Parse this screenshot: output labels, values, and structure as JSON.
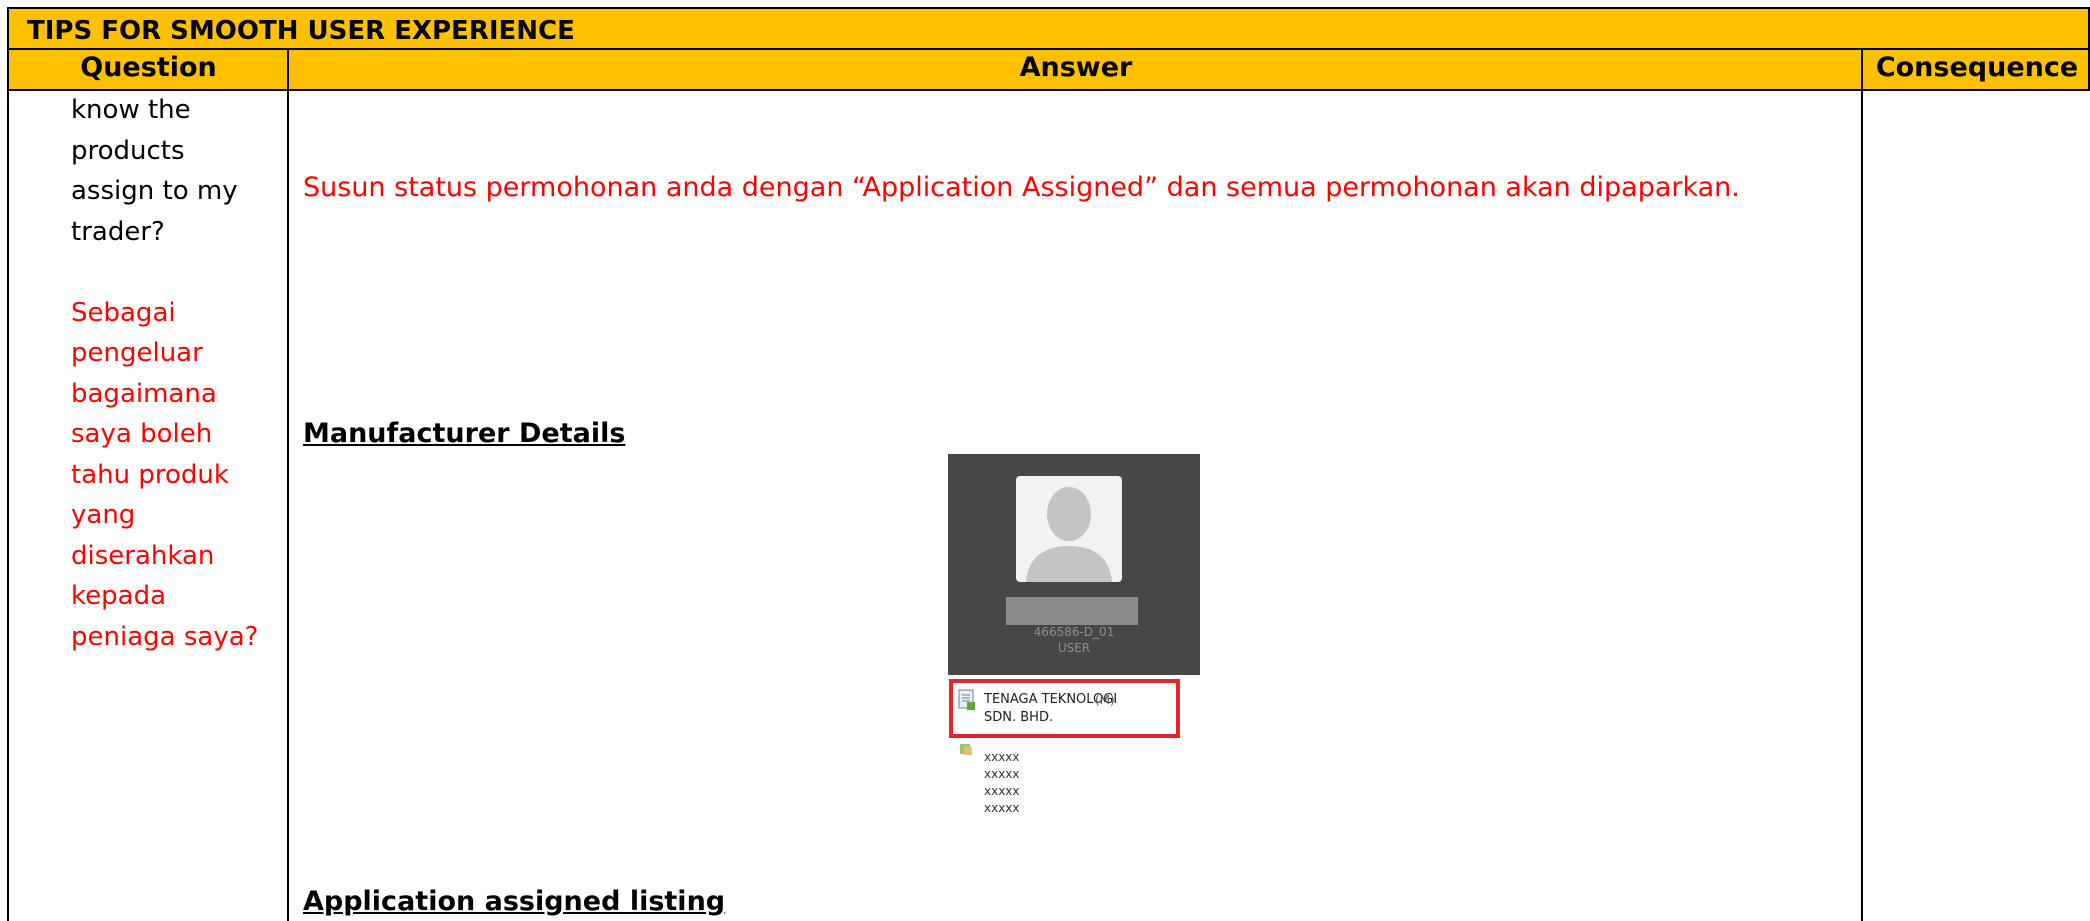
{
  "header": {
    "title": "TIPS FOR SMOOTH USER EXPERIENCE",
    "columns": [
      "Question",
      "Answer",
      "Consequence"
    ]
  },
  "question": {
    "english_lines": [
      "know the",
      "products",
      "assign to my",
      "trader?"
    ],
    "malay_lines": [
      "Sebagai",
      "pengeluar",
      "bagaimana",
      "saya boleh",
      "tahu produk",
      "yang",
      "diserahkan",
      "kepada",
      "peniaga saya?"
    ]
  },
  "answer": {
    "text": "Susun status permohonan anda dengan “Application Assigned” dan semua permohonan akan dipaparkan.",
    "section1": "Manufacturer Details",
    "section2": "Application assigned listing"
  },
  "screenshot": {
    "user_id": "466586-D_01",
    "role": "USER",
    "company_line1": "TENAGA TEKNOLOGI",
    "company_suffix": "(M)",
    "company_line2": "SDN. BHD.",
    "sub_items": [
      "xxxxx",
      "xxxxx",
      "xxxxx",
      "xxxxx"
    ]
  },
  "colors": {
    "header_bg": "#FFC000",
    "highlight": "#e3262d",
    "red_text": "#ff0000"
  }
}
